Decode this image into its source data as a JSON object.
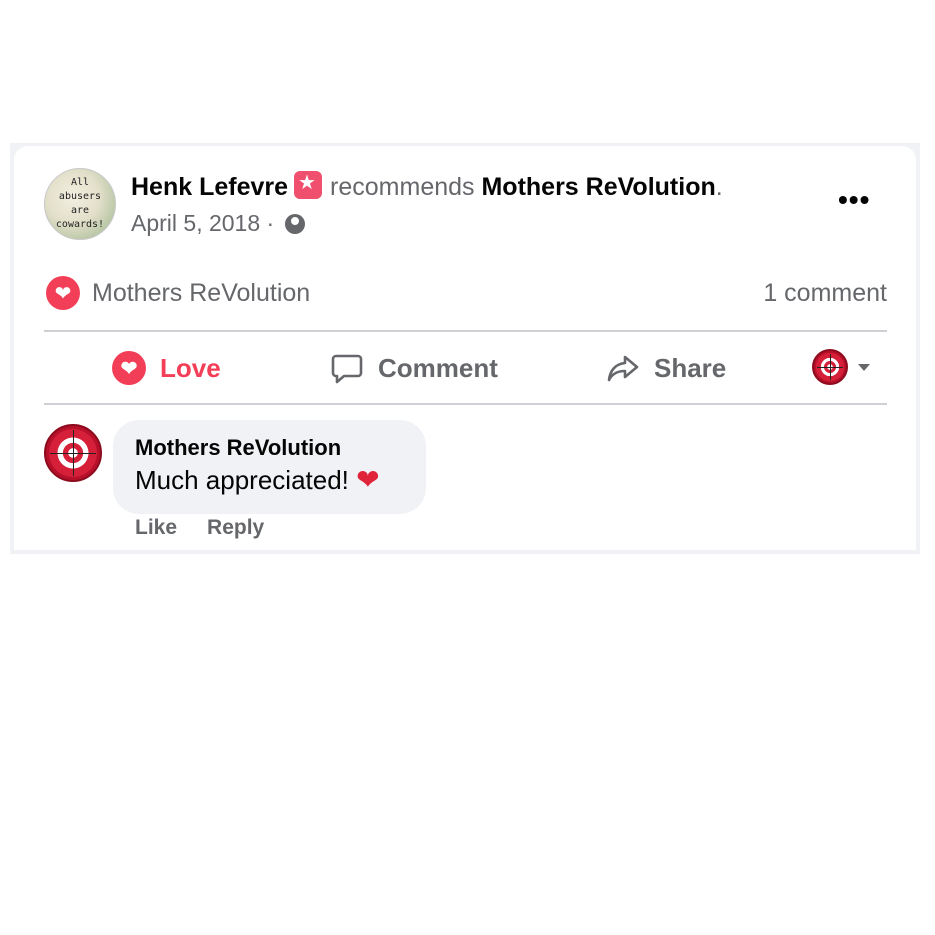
{
  "post": {
    "avatar_text": "All abusers are cowards!",
    "author": "Henk Lefevre",
    "verb": "recommends",
    "page_name": "Mothers ReVolution",
    "period": ".",
    "date": "April 5, 2018",
    "separator": "·",
    "privacy_icon": "globe-icon",
    "more_icon": "more-options-icon",
    "more_glyph": "•••"
  },
  "reactions": {
    "icon": "love-reaction-icon",
    "label": "Mothers ReVolution",
    "comment_count": "1 comment"
  },
  "actions": {
    "love_label": "Love",
    "comment_label": "Comment",
    "share_label": "Share"
  },
  "comment": {
    "author": "Mothers ReVolution",
    "text": "Much appreciated!",
    "emoji": "❤️",
    "like_label": "Like",
    "reply_label": "Reply"
  },
  "colors": {
    "love": "#f33e58",
    "secondary_text": "#65676b",
    "bubble_bg": "#f0f2f5"
  }
}
